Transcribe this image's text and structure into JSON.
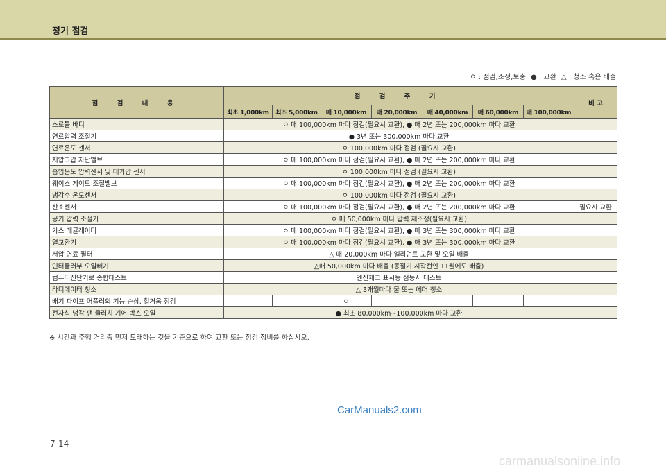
{
  "header": {
    "title": "정기 점검"
  },
  "legend": {
    "inspect": "ㅇ : 점검,조정,보충",
    "replace": "● : 교환",
    "clean": "△ : 청소 혹은 배출"
  },
  "table": {
    "col_item": "점 검 내 용",
    "col_interval": "점 검 주 기",
    "col_note": "비 고",
    "intervals": [
      "최초 1,000km",
      "최초 5,000km",
      "매 10,000km",
      "매 20,000km",
      "매 40,000km",
      "매 60,000km",
      "매 100,000km"
    ],
    "rows": [
      {
        "item": "스로틀 바디",
        "desc": "ㅇ 매 100,000km 마다 점검(필요시 교환), ● 매 2년 또는 200,000km 마다 교환",
        "note": ""
      },
      {
        "item": "연료압력 조절기",
        "desc": "● 3년 또는 300,000km 마다 교환",
        "note": ""
      },
      {
        "item": "연료온도 센서",
        "desc": "ㅇ 100,000km 마다 점검 (필요시 교환)",
        "note": ""
      },
      {
        "item": "저압고압 차단밸브",
        "desc": "ㅇ 매 100,000km 마다 점검(필요시 교환), ● 매 2년 또는 200,000km 마다 교환",
        "note": ""
      },
      {
        "item": "흡입온도 압력센서 및 대기압 센서",
        "desc": "ㅇ 100,000km 마다 점검 (필요시 교환)",
        "note": ""
      },
      {
        "item": "웨이스 게이트 조절밸브",
        "desc": "ㅇ 매 100,000km 마다 점검(필요시 교환), ● 매 2년 또는 200,000km 마다 교환",
        "note": ""
      },
      {
        "item": "냉각수 온도센서",
        "desc": "ㅇ 100,000km 마다 점검 (필요시 교환)",
        "note": ""
      },
      {
        "item": "산소센서",
        "desc": "ㅇ 매 100,000km 마다 점검(필요시 교환), ● 매 2년 또는 200,000km 마다 교환",
        "note": "필요시 교환"
      },
      {
        "item": "공기 압력 조절기",
        "desc": "ㅇ 매 50,000km 마다 압력 재조정(필요시 교환)",
        "note": ""
      },
      {
        "item": "가스 레귤레이터",
        "desc": "ㅇ 매 100,000km 마다 점검(필요시 교환), ● 매 3년 또는 300,000km 마다 교환",
        "note": ""
      },
      {
        "item": "열교환기",
        "desc": "ㅇ 매 100,000km 마다 점검(필요시 교환), ● 매 3년 또는 300,000km 마다 교환",
        "note": ""
      },
      {
        "item": "저압 연료 필터",
        "desc": "△ 매 20,000km 마다 엘리먼트 교환 및 오일 배출",
        "note": ""
      },
      {
        "item": "인터쿨러부 오일빼기",
        "desc": "△매 50,000km 마다 배출 (동절기 시작전인 11월에도 배출)",
        "note": ""
      },
      {
        "item": "컴퓨터진단기로 종합테스트",
        "desc": "엔진체크 표시등 점등시 테스트",
        "note": ""
      },
      {
        "item": "라디에이터 청소",
        "desc": "△ 3개월마다 물 또는 에어 청소",
        "note": ""
      },
      {
        "item": "전자식 냉각 팬 클러치 기어 박스 오일",
        "desc": "● 최초 80,000km~100,000km 마다 교환",
        "note": ""
      }
    ],
    "exhaust_row": {
      "item": "배기 파이프 머플러의 기능 손상, 헐거움 점검",
      "cells": [
        "",
        "",
        "ㅇ",
        "",
        "",
        "",
        ""
      ],
      "note": ""
    }
  },
  "footnote": "※ 시간과 주행 거리중 먼저 도래하는 것을 기준으로 하여 교환 또는 점검·정비를 하십시오.",
  "watermark": "CarManuals2.com",
  "page_number": "7-14",
  "site": "carmanualsonline.info"
}
